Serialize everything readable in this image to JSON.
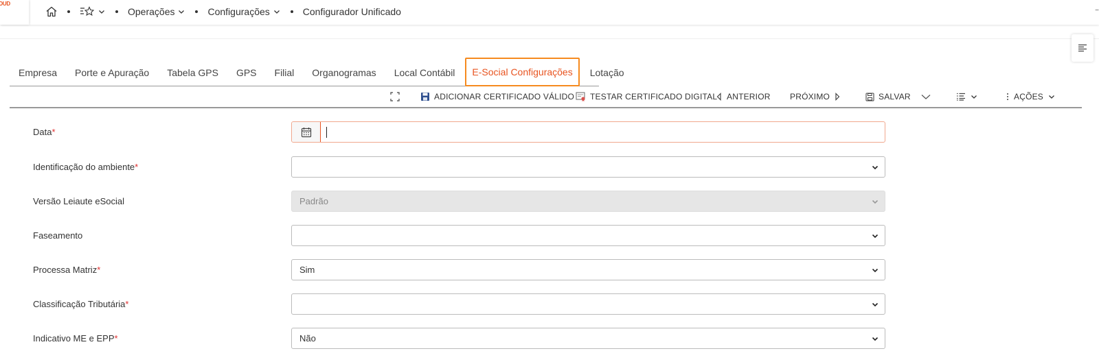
{
  "app": {
    "logo_text": "OUD",
    "right_mark": "−"
  },
  "breadcrumb": {
    "home_icon": "home-icon",
    "favorites_icon": "favorites-star-icon",
    "items": [
      {
        "label": "Operações",
        "has_dropdown": true
      },
      {
        "label": "Configurações",
        "has_dropdown": true
      },
      {
        "label": "Configurador Unificado",
        "has_dropdown": false
      }
    ]
  },
  "tabs": [
    {
      "label": "Empresa"
    },
    {
      "label": "Porte e Apuração"
    },
    {
      "label": "Tabela GPS"
    },
    {
      "label": "GPS"
    },
    {
      "label": "Filial"
    },
    {
      "label": "Organogramas"
    },
    {
      "label": "Local Contábil"
    },
    {
      "label": "E-Social Configurações",
      "active": true
    },
    {
      "label": "Lotação"
    }
  ],
  "toolbar": {
    "expand_icon": "expand-icon",
    "add_certificate": "ADICIONAR CERTIFICADO VÁLIDO",
    "test_certificate": "TESTAR CERTIFICADO DIGITAL",
    "previous": "ANTERIOR",
    "next": "PRÓXIMO",
    "save": "SALVAR",
    "actions": "AÇÕES"
  },
  "form": {
    "data": {
      "label": "Data",
      "required": "*",
      "value": ""
    },
    "ambiente": {
      "label": "Identificação do ambiente",
      "required": "*",
      "value": ""
    },
    "versao": {
      "label": "Versão Leiaute eSocial",
      "value": "Padrão"
    },
    "faseamento": {
      "label": "Faseamento",
      "value": ""
    },
    "processa_matriz": {
      "label": "Processa Matriz",
      "required": "*",
      "value": "Sim"
    },
    "classificacao": {
      "label": "Classificação Tributária",
      "required": "*",
      "value": ""
    },
    "indicativo": {
      "label": "Indicativo ME e EPP",
      "required": "*",
      "value": "Não"
    }
  },
  "colors": {
    "accent": "#e8531f",
    "highlight_border": "#f68a1e",
    "required": "#e03030"
  }
}
